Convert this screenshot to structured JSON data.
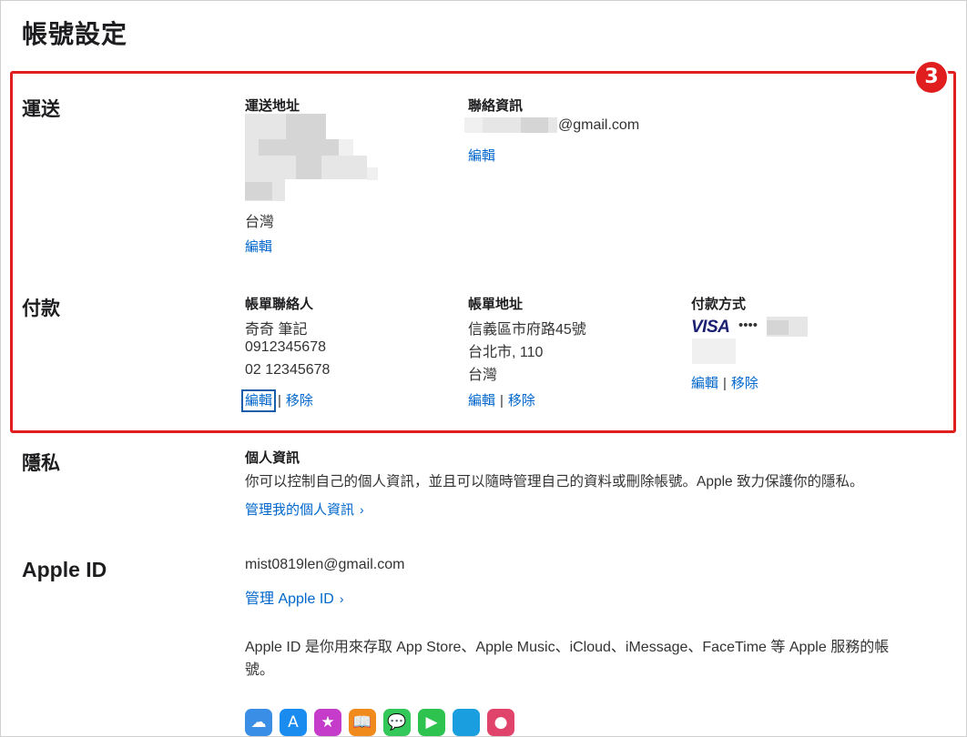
{
  "page": {
    "title": "帳號設定",
    "step_number": "3"
  },
  "shipping": {
    "section_title": "運送",
    "address": {
      "title": "運送地址",
      "country": "台灣",
      "edit_label": "編輯"
    },
    "contact": {
      "title": "聯絡資訊",
      "email_suffix": "@gmail.com",
      "edit_label": "編輯"
    }
  },
  "payment": {
    "section_title": "付款",
    "billing_contact": {
      "title": "帳單聯絡人",
      "name": "奇奇 筆記",
      "phone1": "0912345678",
      "phone2": "02 12345678",
      "edit_label": "編輯",
      "separator": "|",
      "remove_label": "移除"
    },
    "billing_address": {
      "title": "帳單地址",
      "line1": "信義區市府路45號",
      "line2": "台北市, 110",
      "country": "台灣",
      "edit_label": "編輯",
      "separator": "|",
      "remove_label": "移除"
    },
    "payment_method": {
      "title": "付款方式",
      "card_brand": "VISA",
      "card_mask": "••••",
      "edit_label": "編輯",
      "separator": "|",
      "remove_label": "移除"
    }
  },
  "privacy": {
    "section_title": "隱私",
    "title": "個人資訊",
    "description": "你可以控制自己的個人資訊，並且可以隨時管理自己的資料或刪除帳號。Apple 致力保護你的隱私。",
    "manage_label": "管理我的個人資訊",
    "chevron": "›"
  },
  "apple_id": {
    "section_title": "Apple ID",
    "email": "mist0819len@gmail.com",
    "manage_label": "管理 Apple ID",
    "chevron": "›",
    "description": "Apple ID 是你用來存取 App Store、Apple Music、iCloud、iMessage、FaceTime 等 Apple 服務的帳號。",
    "services": [
      {
        "name": "icloud-icon",
        "glyph": "☁",
        "color": "#3a8ee6"
      },
      {
        "name": "app-store-icon",
        "glyph": "A",
        "color": "#1a8cf0"
      },
      {
        "name": "itunes-store-icon",
        "glyph": "★",
        "color": "#c43cc9"
      },
      {
        "name": "books-icon",
        "glyph": "📖",
        "color": "#f08a1c"
      },
      {
        "name": "messages-icon",
        "glyph": "💬",
        "color": "#34c759"
      },
      {
        "name": "facetime-icon",
        "glyph": "▶",
        "color": "#2ec24f"
      },
      {
        "name": "apple-store-icon",
        "glyph": "",
        "color": "#1a9ee0"
      },
      {
        "name": "game-center-icon",
        "glyph": "●",
        "color": "#e0446a"
      }
    ]
  }
}
